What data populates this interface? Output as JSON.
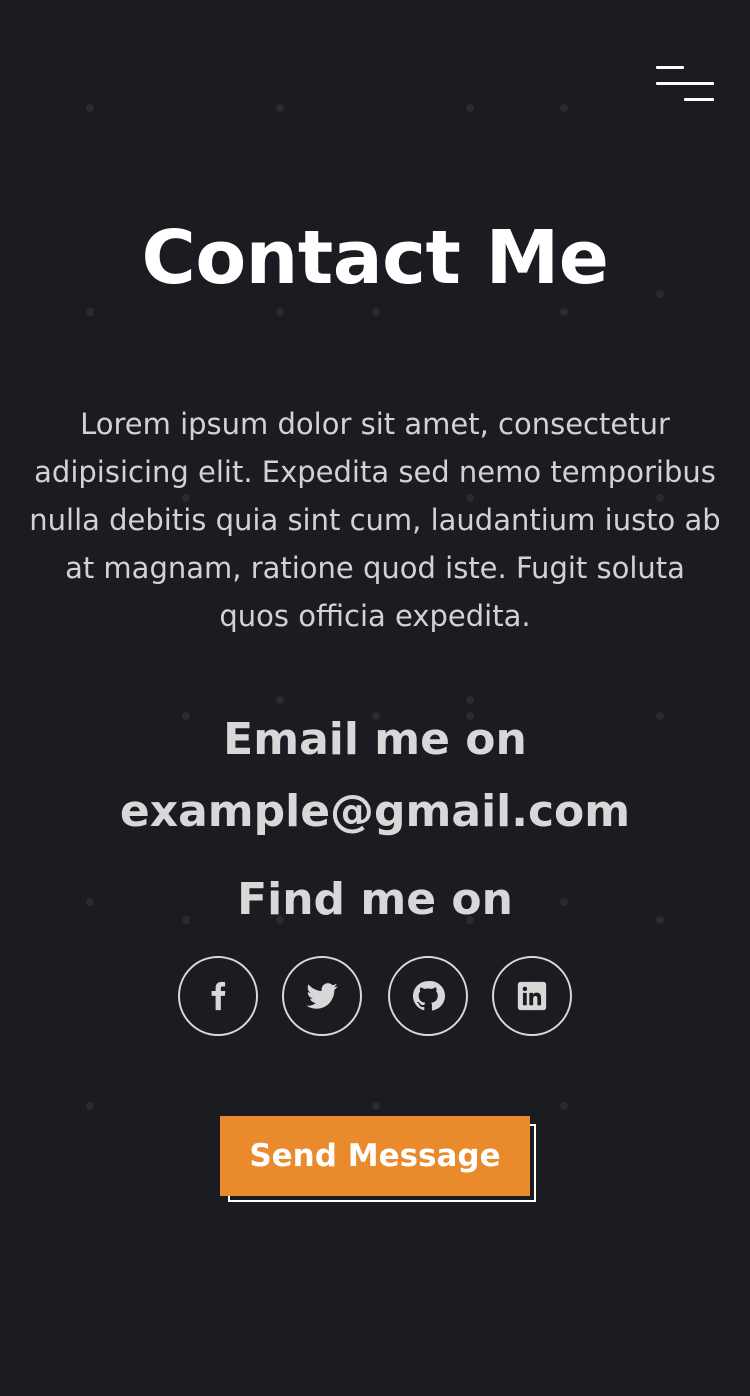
{
  "header": {
    "menu_icon": "hamburger-menu-icon"
  },
  "contact": {
    "title": "Contact Me",
    "intro": "Lorem ipsum dolor sit amet, consectetur adipisicing elit. Expedita sed nemo temporibus nulla debitis quia sint cum, laudantium iusto ab at magnam, ratione quod iste. Fugit soluta quos officia expedita.",
    "email_label": "Email me on",
    "email": "example@gmail.com",
    "find_label": "Find me on",
    "social": [
      {
        "name": "facebook",
        "icon": "facebook-icon"
      },
      {
        "name": "twitter",
        "icon": "twitter-icon"
      },
      {
        "name": "github",
        "icon": "github-icon"
      },
      {
        "name": "linkedin",
        "icon": "linkedin-icon"
      }
    ],
    "send_button": "Send Message"
  },
  "colors": {
    "background": "#1b1c21",
    "accent": "#e98b2c",
    "text": "#d8d8d8",
    "dot": "#2a2b31"
  }
}
